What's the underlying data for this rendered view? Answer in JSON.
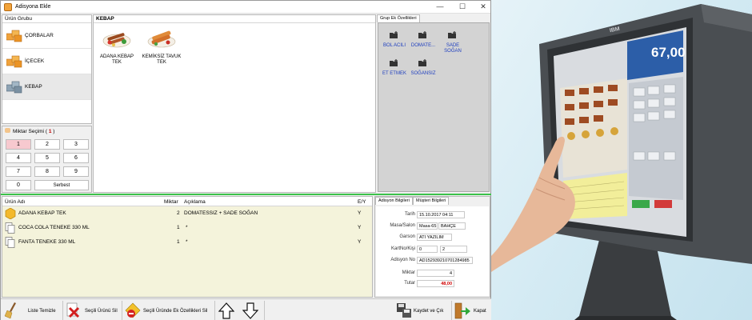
{
  "window": {
    "title": "Adisyona Ekle",
    "minimize": "—",
    "maximize": "☐",
    "close": "✕"
  },
  "groups": {
    "header": "Ürün Grubu",
    "items": [
      {
        "label": "ÇORBALAR"
      },
      {
        "label": "İÇECEK"
      },
      {
        "label": "KEBAP"
      }
    ]
  },
  "quantity": {
    "label": "Miktar Seçimi",
    "open_paren": "(",
    "value": "1",
    "close_paren": ")",
    "keys": [
      "1",
      "2",
      "3",
      "4",
      "5",
      "6",
      "7",
      "8",
      "9",
      "0"
    ],
    "free_key": "Serbest"
  },
  "products": {
    "header": "KEBAP",
    "items": [
      {
        "line1": "ADANA KEBAP",
        "line2": "TEK"
      },
      {
        "line1": "KEMİKSİZ TAVUK",
        "line2": "TEK"
      }
    ]
  },
  "extras": {
    "tab": "Grup Ek Özellikleri",
    "items": [
      {
        "line1": "BOL ACILI",
        "line2": ""
      },
      {
        "line1": "DOMATE...",
        "line2": ""
      },
      {
        "line1": "SADE",
        "line2": "SOĞAN"
      },
      {
        "line1": "ET ETMEK",
        "line2": ""
      },
      {
        "line1": "SOĞANSIZ",
        "line2": ""
      }
    ]
  },
  "orders": {
    "columns": {
      "name": "Ürün Adı",
      "qty": "Miktar",
      "desc": "Açıklama",
      "ey": "E/Y"
    },
    "rows": [
      {
        "name": "ADANA KEBAP TEK",
        "qty": "2",
        "desc": "DOMATESSIZ + SADE SOĞAN",
        "ey": "Y"
      },
      {
        "name": "COCA COLA TENEKE 330 ML",
        "qty": "1",
        "desc": "*",
        "ey": "Y"
      },
      {
        "name": "FANTA TENEKE 330 ML",
        "qty": "1",
        "desc": "*",
        "ey": "Y"
      }
    ]
  },
  "info": {
    "tabs": [
      "Adisyon Bilgileri",
      "Müşteri Bilgileri"
    ],
    "date_label": "Tarih",
    "date": "15.10.2017 04:11",
    "table_label": "Masa/Salon",
    "table": "Masa-65",
    "salon": "BAHÇE",
    "waiter_label": "Garson",
    "waiter": "ATI YAZILIM",
    "card_label": "KartNo/Kişi",
    "card": "0",
    "persons": "2",
    "no_label": "Adisyon No",
    "no": "AD152939210701284985",
    "qty_label": "Miktar",
    "qty": "4",
    "total_label": "Tutar",
    "total": "48,00",
    "total_color": "#d00000"
  },
  "toolbar": {
    "clear": "Liste Temizle",
    "delete": "Seçili Ürünü Sil",
    "delete_extras": "Seçili Üründe Ek Özellikleri Sil",
    "save_exit": "Kaydet ve Çık",
    "close": "Kapat"
  },
  "photo": {
    "screen_total": "67,00",
    "brand": "IBM"
  },
  "colors": {
    "divider": "#3cc24a",
    "order_bg": "#f4f3db",
    "extras_text": "#1f3fbf",
    "key_highlight": "#f7c9cf"
  }
}
